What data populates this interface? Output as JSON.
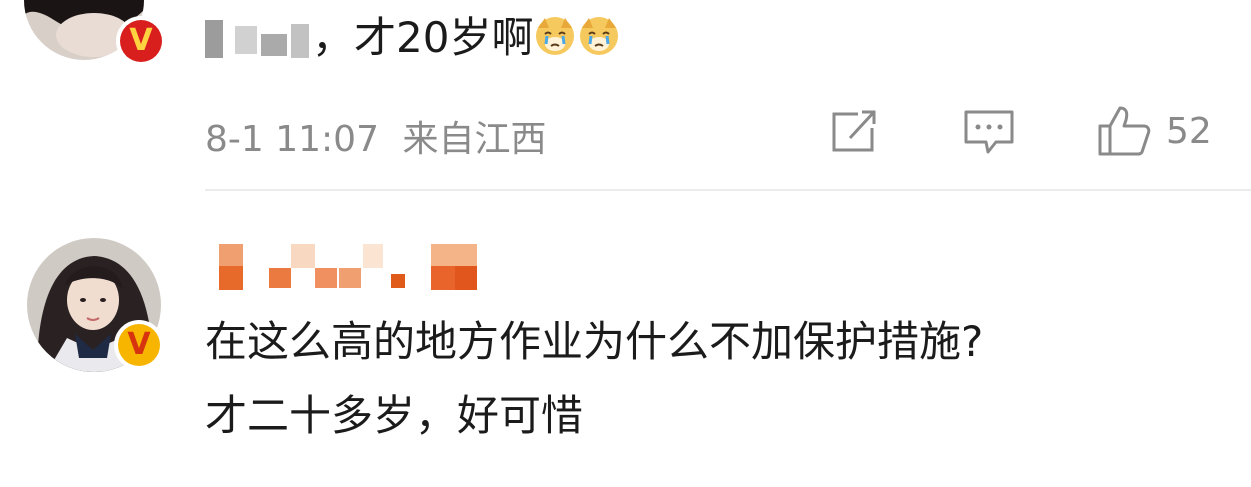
{
  "comments": [
    {
      "text_visible": "，才20岁啊",
      "meta": {
        "date_time": "8-1 11:07",
        "location": "来自江西"
      },
      "actions": {
        "share_icon": "share-icon",
        "reply_icon": "comment-icon",
        "like_icon": "thumbs-up-icon",
        "like_count": "52"
      },
      "emojis": [
        "crying-dog-emoji",
        "crying-dog-emoji"
      ]
    },
    {
      "text_line1": "在这么高的地方作业为什么不加保护措施?",
      "text_line2": "才二十多岁，好可惜"
    }
  ],
  "colors": {
    "verified_badge": "#f7b500",
    "verified_v": "#d8330f",
    "meta_gray": "#8a8a8a",
    "divider": "#ececec"
  }
}
